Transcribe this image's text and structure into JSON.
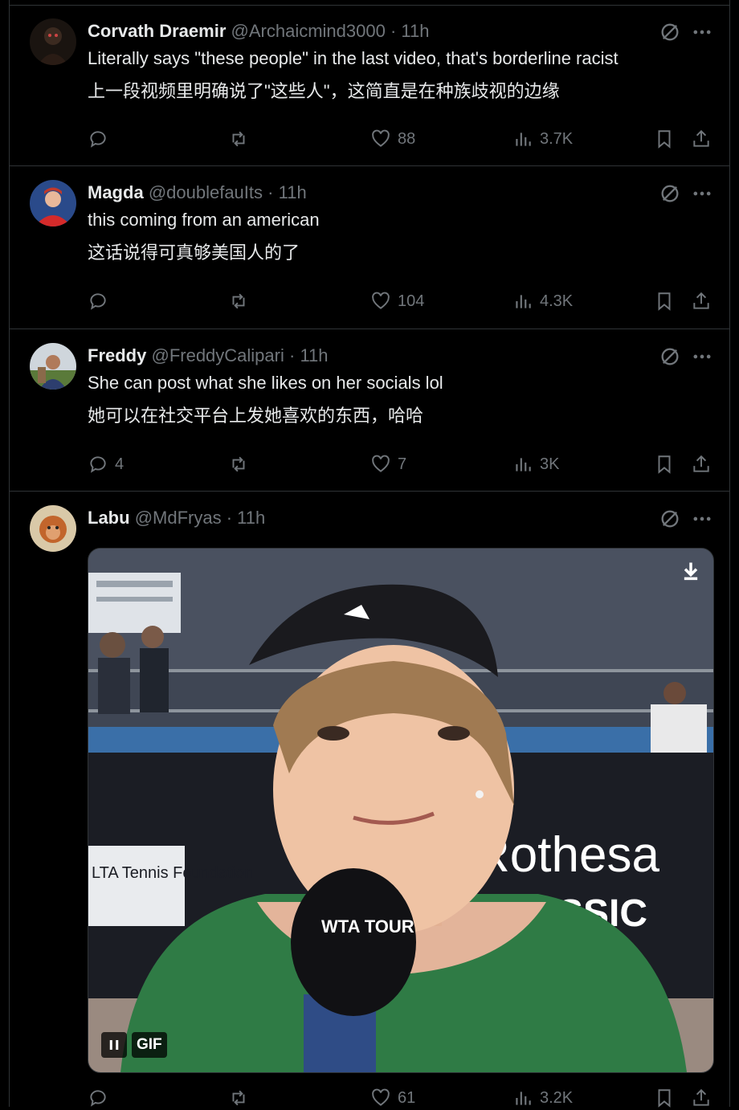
{
  "colors": {
    "background": "#000000",
    "text": "#e7e9ea",
    "muted": "#71767b",
    "divider": "#2f3336"
  },
  "tweets": [
    {
      "name": "Corvath Draemir",
      "handle": "@Archaicmind3000",
      "dot": "·",
      "time": "11h",
      "text_en": "Literally says \"these people\" in the last video, that's borderline racist",
      "text_zh": "上一段视频里明确说了\"这些人\"，这简直是在种族歧视的边缘",
      "replies": "",
      "retweets": "",
      "likes": "88",
      "views": "3.7K"
    },
    {
      "name": "Magda",
      "handle": "@doublefauIts",
      "dot": "·",
      "time": "11h",
      "text_en": "this coming from an american",
      "text_zh": "这话说得可真够美国人的了",
      "replies": "",
      "retweets": "",
      "likes": "104",
      "views": "4.3K"
    },
    {
      "name": "Freddy",
      "handle": "@FreddyCalipari",
      "dot": "·",
      "time": "11h",
      "text_en": "She can post what she likes on her socials lol",
      "text_zh": "她可以在社交平台上发她喜欢的东西，哈哈",
      "replies": "4",
      "retweets": "",
      "likes": "7",
      "views": "3K"
    },
    {
      "name": "Labu",
      "handle": "@MdFryas",
      "dot": "·",
      "time": "11h",
      "media": {
        "gif_label": "GIF",
        "sign_text": "Rothesa",
        "sign_text2": "LASSIC",
        "board_text": "LTA Tennis Foundation",
        "mic_text": "WTA TOUR"
      },
      "replies": "",
      "retweets": "",
      "likes": "61",
      "views": "3.2K"
    }
  ],
  "icons": [
    "reply-icon",
    "retweet-icon",
    "like-icon",
    "views-icon",
    "bookmark-icon",
    "share-icon",
    "grok-icon",
    "more-icon",
    "download-icon",
    "pause-icon"
  ]
}
